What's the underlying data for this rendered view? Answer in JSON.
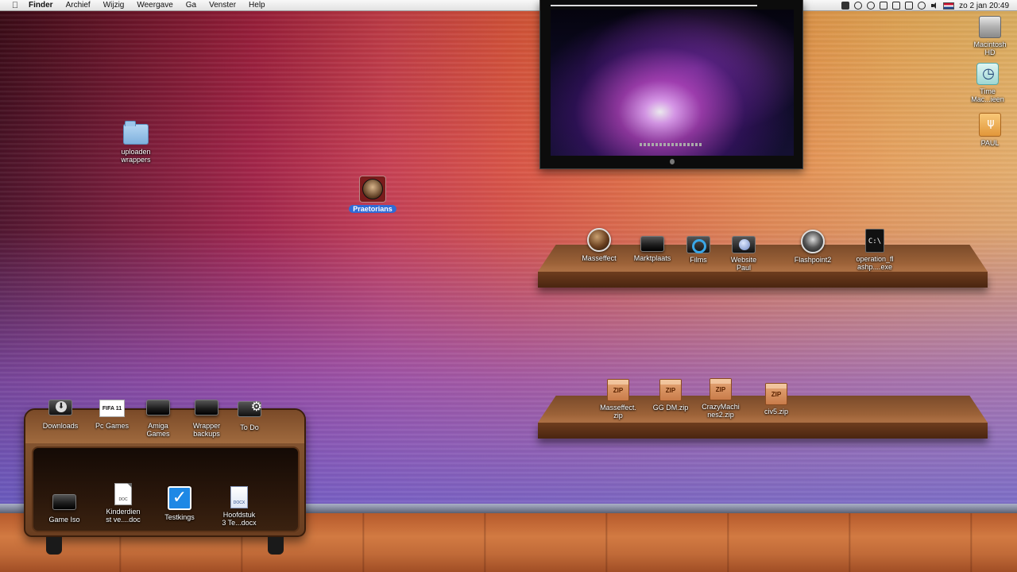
{
  "menubar": {
    "app": "Finder",
    "menus": [
      "Archief",
      "Wijzig",
      "Weergave",
      "Ga",
      "Venster",
      "Help"
    ],
    "clock": "zo 2 jan  20:49"
  },
  "desktop": {
    "folder_uploaden": "uploaden\nwrappers",
    "praetorians": "Praetorians",
    "right_column": {
      "macintosh_hd": "Macintosh\nHD",
      "time_machine": "Time\nMac...ieen",
      "paul": "PAUL"
    }
  },
  "top_shelf": {
    "items": [
      {
        "label": "Masseffect",
        "icon": "masseffect-app-icon"
      },
      {
        "label": "Marktplaats",
        "icon": "drive-icon"
      },
      {
        "label": "Films",
        "icon": "quicktime-icon"
      },
      {
        "label": "Website\nPaul",
        "icon": "web-icon"
      },
      {
        "label": "Flashpoint2",
        "icon": "flashpoint-app-icon"
      },
      {
        "label": "operation_fl\nashp....exe",
        "icon": "exe-icon"
      }
    ]
  },
  "bottom_shelf": {
    "items": [
      {
        "label": "Masseffect.\nzip",
        "badge": "ZIP"
      },
      {
        "label": "GG DM.zip",
        "badge": "ZIP"
      },
      {
        "label": "CrazyMachi\nnes2.zip",
        "badge": "ZIP"
      },
      {
        "label": "civ5.zip",
        "badge": "ZIP"
      }
    ]
  },
  "cabinet": {
    "top_row": [
      {
        "label": "Downloads"
      },
      {
        "label": "Pc Games",
        "badge": "FIFA 11"
      },
      {
        "label": "Amiga\nGames"
      },
      {
        "label": "Wrapper\nbackups"
      },
      {
        "label": "To Do"
      }
    ],
    "inner_row": [
      {
        "label": "Game Iso"
      },
      {
        "label": "Kinderdien\nst ve....doc",
        "badge": "DOC"
      },
      {
        "label": "Testkings",
        "badge": "✓"
      },
      {
        "label": "Hoofdstuk\n3 Te...docx",
        "badge": "DOCX"
      }
    ]
  }
}
